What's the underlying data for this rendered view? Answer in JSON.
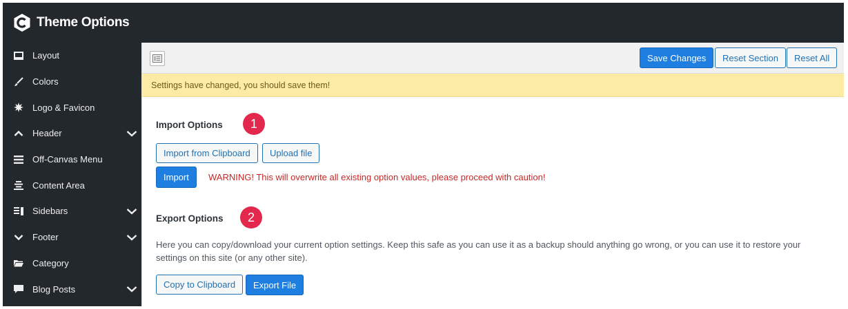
{
  "header": {
    "app_title": "Theme Options"
  },
  "sidebar": {
    "items": [
      {
        "label": "Layout",
        "icon": "layout-icon",
        "has_submenu": false
      },
      {
        "label": "Colors",
        "icon": "brush-icon",
        "has_submenu": false
      },
      {
        "label": "Logo & Favicon",
        "icon": "sun-burst-icon",
        "has_submenu": false
      },
      {
        "label": "Header",
        "icon": "chevron-up-icon",
        "has_submenu": true
      },
      {
        "label": "Off-Canvas Menu",
        "icon": "menu-icon",
        "has_submenu": false
      },
      {
        "label": "Content Area",
        "icon": "align-center-icon",
        "has_submenu": false
      },
      {
        "label": "Sidebars",
        "icon": "sidebar-icon",
        "has_submenu": true
      },
      {
        "label": "Footer",
        "icon": "chevron-down-icon",
        "has_submenu": true
      },
      {
        "label": "Category",
        "icon": "folder-icon",
        "has_submenu": false
      },
      {
        "label": "Blog Posts",
        "icon": "comment-icon",
        "has_submenu": true
      }
    ]
  },
  "toolbar": {
    "save_label": "Save Changes",
    "reset_section_label": "Reset Section",
    "reset_all_label": "Reset All"
  },
  "notice": {
    "text": "Settings have changed, you should save them!"
  },
  "import": {
    "title": "Import Options",
    "badge": "1",
    "clipboard_label": "Import from Clipboard",
    "upload_label": "Upload file",
    "import_label": "Import",
    "warning": "WARNING! This will overwrite all existing option values, please proceed with caution!"
  },
  "export": {
    "title": "Export Options",
    "badge": "2",
    "description": "Here you can copy/download your current option settings. Keep this safe as you can use it as a backup should anything go wrong, or you can use it to restore your settings on this site (or any other site).",
    "copy_label": "Copy to Clipboard",
    "file_label": "Export File"
  },
  "colors": {
    "primary": "#1e7fe0",
    "sidebar_bg": "#23282d",
    "notice_bg": "#fbeba5",
    "warning": "#c62828",
    "badge": "#e3284e"
  }
}
